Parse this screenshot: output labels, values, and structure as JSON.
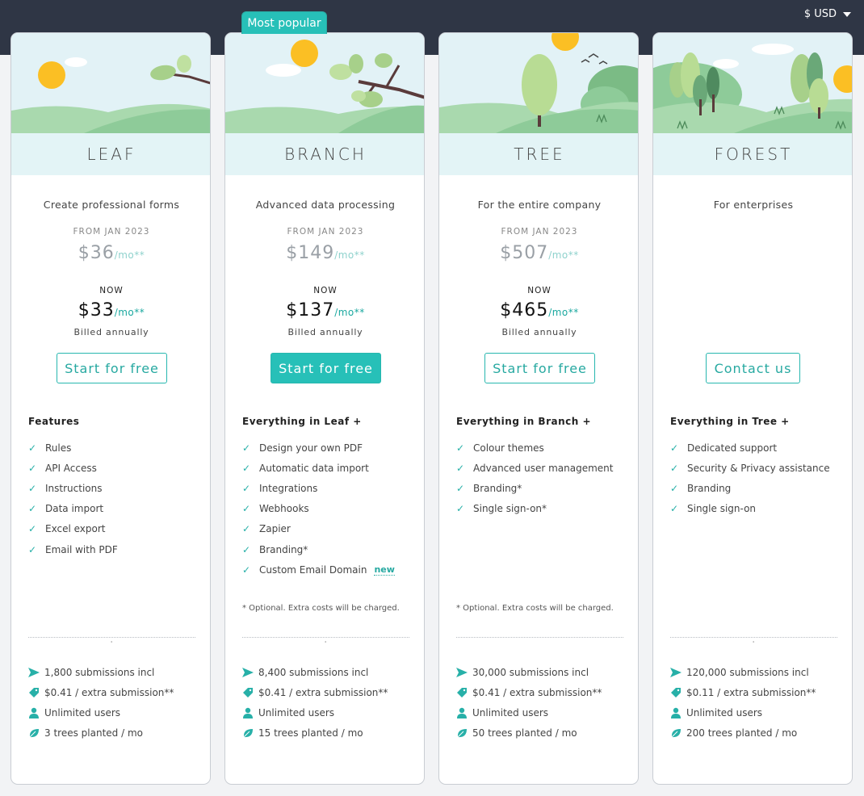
{
  "currency": {
    "label": "$ USD"
  },
  "badge": {
    "label": "Most popular"
  },
  "colors": {
    "accent": "#27c0b8",
    "header_bg": "#2f3645",
    "plan_bar_bg": "#e3f4f6"
  },
  "plans": [
    {
      "name": "LEAF",
      "tagline": "Create professional forms",
      "from_label": "FROM JAN 2023",
      "old_price": "$36",
      "old_per": "/mo**",
      "now_label": "NOW",
      "new_price": "$33",
      "new_per": "/mo**",
      "billed": "Billed annually",
      "cta": "Start for free",
      "features_heading": "Features",
      "features": [
        "Rules",
        "API Access",
        "Instructions",
        "Data import",
        "Excel export",
        "Email with PDF"
      ],
      "stats": {
        "submissions": "1,800 submissions incl",
        "extra": "$0.41 / extra submission**",
        "users": "Unlimited users",
        "trees": "3 trees planted / mo"
      }
    },
    {
      "name": "BRANCH",
      "tagline": "Advanced data processing",
      "from_label": "FROM JAN 2023",
      "old_price": "$149",
      "old_per": "/mo**",
      "now_label": "NOW",
      "new_price": "$137",
      "new_per": "/mo**",
      "billed": "Billed annually",
      "cta": "Start for free",
      "features_heading": "Everything in Leaf +",
      "features": [
        "Design your own PDF",
        "Automatic data import",
        "Integrations",
        "Webhooks",
        "Zapier",
        "Branding*",
        "Custom Email Domain"
      ],
      "new_tag": "new",
      "note": "* Optional. Extra costs will be charged.",
      "stats": {
        "submissions": "8,400 submissions incl",
        "extra": "$0.41 / extra submission**",
        "users": "Unlimited users",
        "trees": "15 trees planted / mo"
      }
    },
    {
      "name": "TREE",
      "tagline": "For the entire company",
      "from_label": "FROM JAN 2023",
      "old_price": "$507",
      "old_per": "/mo**",
      "now_label": "NOW",
      "new_price": "$465",
      "new_per": "/mo**",
      "billed": "Billed annually",
      "cta": "Start for free",
      "features_heading": "Everything in Branch +",
      "features": [
        "Colour themes",
        "Advanced user management",
        "Branding*",
        "Single sign-on*"
      ],
      "note": "* Optional. Extra costs will be charged.",
      "stats": {
        "submissions": "30,000 submissions incl",
        "extra": "$0.41 / extra submission**",
        "users": "Unlimited users",
        "trees": "50 trees planted / mo"
      }
    },
    {
      "name": "FOREST",
      "tagline": "For enterprises",
      "cta": "Contact us",
      "features_heading": "Everything in Tree +",
      "features": [
        "Dedicated support",
        "Security & Privacy assistance",
        "Branding",
        "Single sign-on"
      ],
      "stats": {
        "submissions": "120,000 submissions incl",
        "extra": "$0.11 / extra submission**",
        "users": "Unlimited users",
        "trees": "200 trees planted / mo"
      }
    }
  ]
}
